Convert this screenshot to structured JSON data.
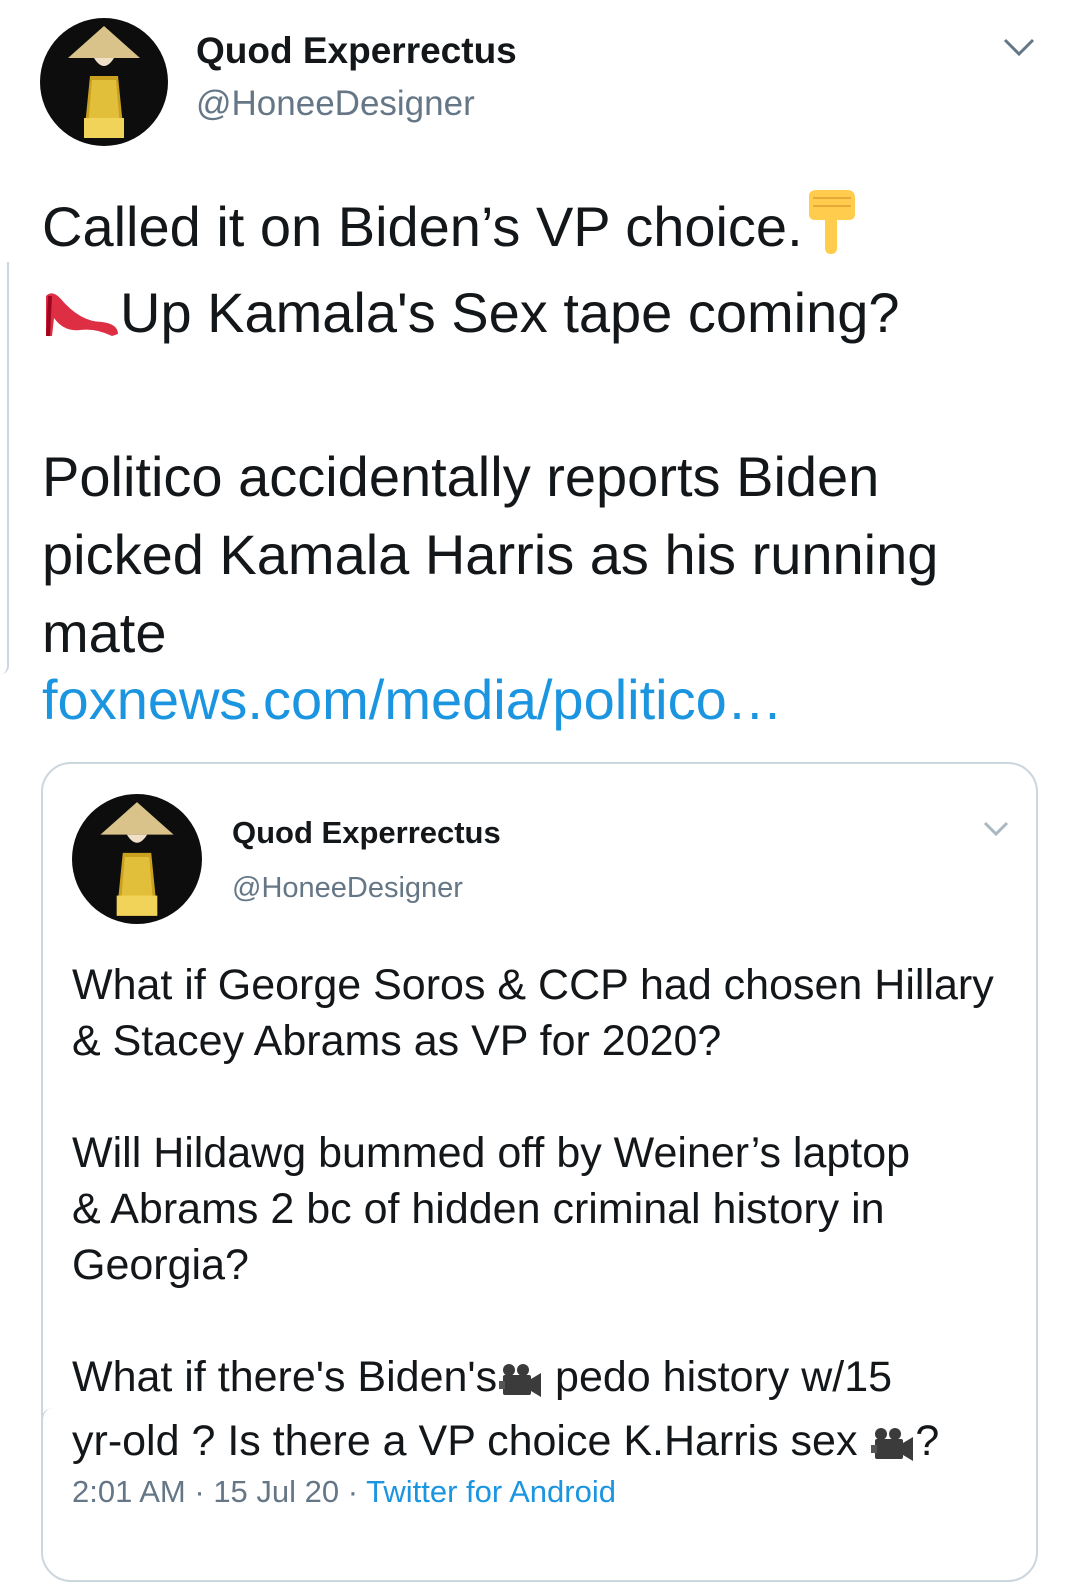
{
  "tweet": {
    "display_name": "Quod Experrectus",
    "handle": "@HoneeDesigner",
    "line1": "Called it on Biden’s VP choice.",
    "line2": "Up Kamala's Sex tape coming?",
    "body": "Politico accidentally reports Biden\npicked Kamala Harris as his running\nmate",
    "link": "foxnews.com/media/politico…",
    "emoji_1": "pointing-down-emoji",
    "emoji_2": "high-heel-emoji"
  },
  "quoted": {
    "display_name": "Quod Experrectus",
    "handle": "@HoneeDesigner",
    "para1": "What if George Soros & CCP had chosen Hillary\n& Stacey Abrams as VP for 2020?",
    "para2": "Will Hildawg bummed off by Weiner’s laptop\n& Abrams 2 bc of hidden criminal history in\nGeorgia?",
    "para3_a": "What if there's Biden's",
    "para3_b": " pedo history w/15\nyr-old ? Is there a VP choice K.Harris sex ",
    "para3_c": "?",
    "emoji": "movie-camera-emoji",
    "time": "2:01 AM",
    "date": "15 Jul 20",
    "source": "Twitter for Android",
    "separator": " · "
  },
  "colors": {
    "link": "#1b95e0",
    "secondary": "#657786",
    "border": "#ccd6dd"
  }
}
